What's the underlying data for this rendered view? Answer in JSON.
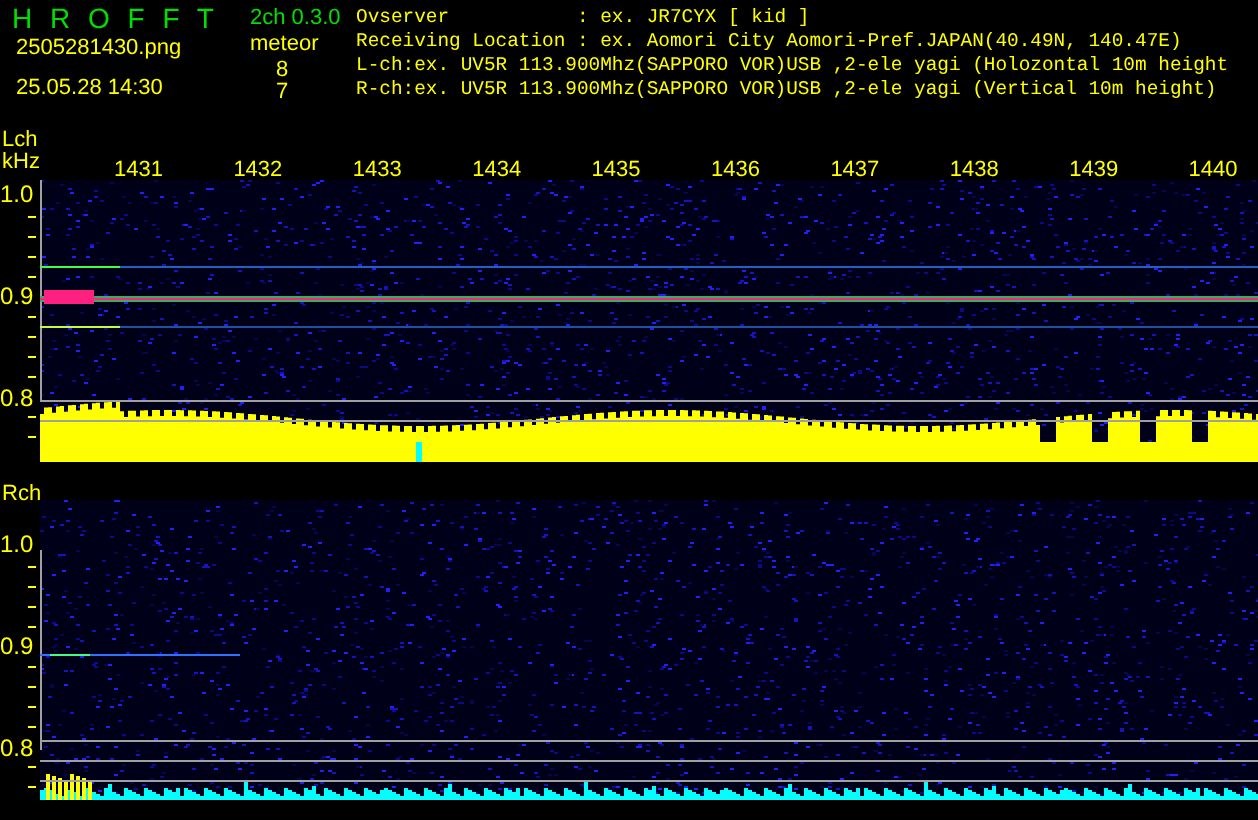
{
  "header": {
    "app_title": "H R O F F T",
    "version": "2ch 0.3.0",
    "file_name": "2505281430.png",
    "timestamp": "25.05.28 14:30",
    "meteor_label": "meteor",
    "meteor_counts": [
      "8",
      "7"
    ],
    "info_lines": [
      "Ovserver           : ex. JR7CYX [ kid ]",
      "Receiving Location : ex. Aomori City Aomori-Pref.JAPAN(40.49N, 140.47E)",
      "L-ch:ex. UV5R 113.900Mhz(SAPPORO VOR)USB ,2-ele yagi (Holozontal 10m height",
      "R-ch:ex. UV5R 113.900Mhz(SAPPORO VOR)USB ,2-ele yagi (Vertical 10m height)"
    ]
  },
  "time_ticks": [
    "1431",
    "1432",
    "1433",
    "1434",
    "1435",
    "1436",
    "1437",
    "1438",
    "1439",
    "1440"
  ],
  "channels": [
    {
      "label": "Lch",
      "unit": "kHz",
      "freq_labels": [
        "1.0",
        "0.9",
        "0.8"
      ]
    },
    {
      "label": "Rch",
      "freq_labels": [
        "1.0",
        "0.9",
        "0.8"
      ]
    }
  ]
}
